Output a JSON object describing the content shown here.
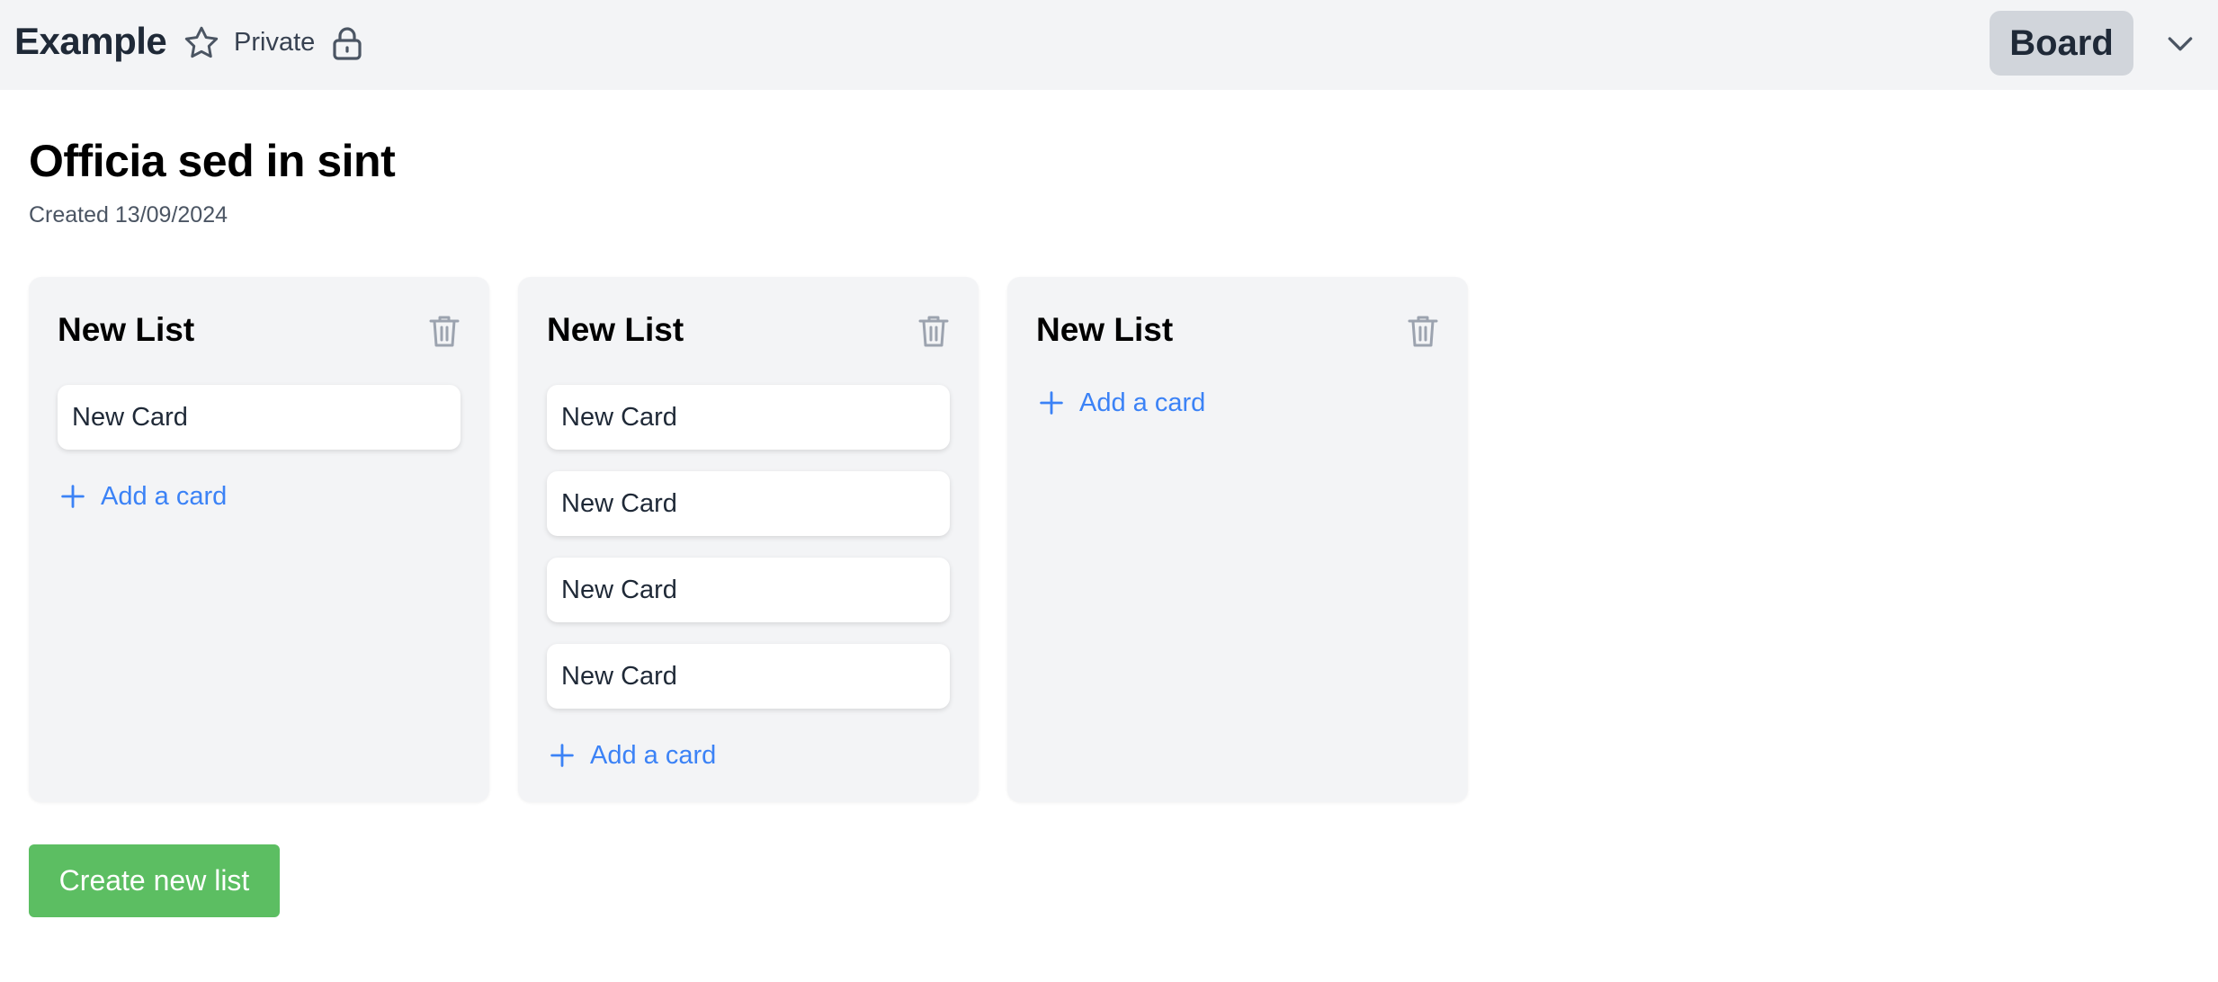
{
  "header": {
    "title": "Example",
    "privacy_label": "Private",
    "view_button_label": "Board",
    "icons": [
      "star-icon",
      "lock-icon",
      "chevron-down-icon"
    ]
  },
  "board": {
    "title": "Officia sed in sint",
    "created": "Created 13/09/2024"
  },
  "lists": [
    {
      "title": "New List",
      "cards": [
        "New Card"
      ],
      "add_card_label": "Add a card"
    },
    {
      "title": "New List",
      "cards": [
        "New Card",
        "New Card",
        "New Card",
        "New Card"
      ],
      "add_card_label": "Add a card"
    },
    {
      "title": "New List",
      "cards": [],
      "add_card_label": "Add a card"
    }
  ],
  "create_list_label": "Create new list",
  "colors": {
    "topbar": "#f3f4f6",
    "list_bg": "#f3f4f6",
    "link": "#3b82f6",
    "create_button": "#5cbe62",
    "board_button": "#d1d5db"
  }
}
